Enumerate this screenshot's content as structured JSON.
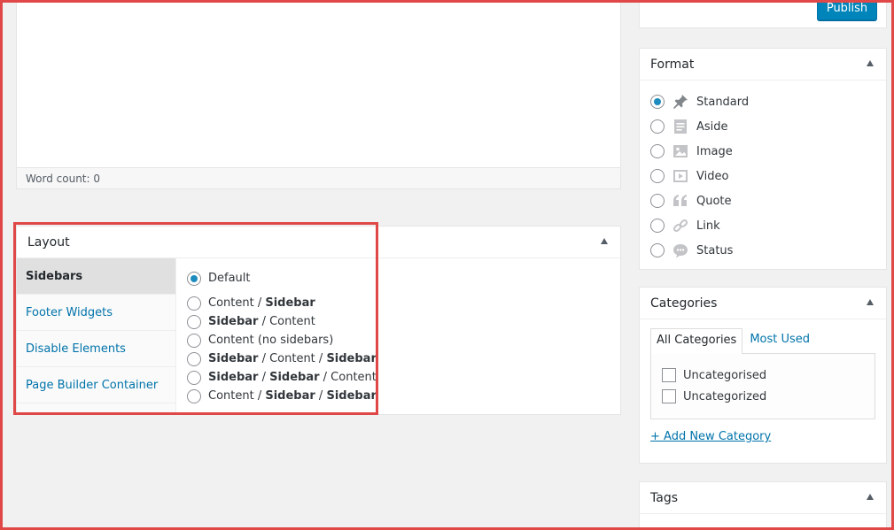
{
  "editor": {
    "word_count": "Word count: 0"
  },
  "layout": {
    "title": "Layout",
    "tabs": [
      {
        "label": "Sidebars",
        "active": true
      },
      {
        "label": "Footer Widgets",
        "active": false
      },
      {
        "label": "Disable Elements",
        "active": false
      },
      {
        "label": "Page Builder Container",
        "active": false
      }
    ],
    "default_label": "Default",
    "options": [
      {
        "parts": [
          {
            "t": "Content",
            "b": false
          },
          {
            "t": " / ",
            "b": false
          },
          {
            "t": "Sidebar",
            "b": true
          }
        ]
      },
      {
        "parts": [
          {
            "t": "Sidebar",
            "b": true
          },
          {
            "t": " / ",
            "b": false
          },
          {
            "t": "Content",
            "b": false
          }
        ]
      },
      {
        "parts": [
          {
            "t": "Content (no sidebars)",
            "b": false
          }
        ]
      },
      {
        "parts": [
          {
            "t": "Sidebar",
            "b": true
          },
          {
            "t": " / Content / ",
            "b": false
          },
          {
            "t": "Sidebar",
            "b": true
          }
        ]
      },
      {
        "parts": [
          {
            "t": "Sidebar",
            "b": true
          },
          {
            "t": " / ",
            "b": false
          },
          {
            "t": "Sidebar",
            "b": true
          },
          {
            "t": " / Content",
            "b": false
          }
        ]
      },
      {
        "parts": [
          {
            "t": "Content / ",
            "b": false
          },
          {
            "t": "Sidebar",
            "b": true
          },
          {
            "t": " / ",
            "b": false
          },
          {
            "t": "Sidebar",
            "b": true
          }
        ]
      }
    ]
  },
  "publish": {
    "button_label": "Publish"
  },
  "format": {
    "title": "Format",
    "options": [
      {
        "label": "Standard",
        "icon": "pin-icon",
        "checked": true
      },
      {
        "label": "Aside",
        "icon": "aside-icon",
        "checked": false
      },
      {
        "label": "Image",
        "icon": "image-icon",
        "checked": false
      },
      {
        "label": "Video",
        "icon": "video-icon",
        "checked": false
      },
      {
        "label": "Quote",
        "icon": "quote-icon",
        "checked": false
      },
      {
        "label": "Link",
        "icon": "link-icon",
        "checked": false
      },
      {
        "label": "Status",
        "icon": "status-icon",
        "checked": false
      }
    ]
  },
  "categories": {
    "title": "Categories",
    "tab_all": "All Categories",
    "tab_used": "Most Used",
    "items": [
      "Uncategorised",
      "Uncategorized"
    ],
    "add_new": "+ Add New Category"
  },
  "tags": {
    "title": "Tags"
  },
  "colors": {
    "accent": "#0073aa",
    "highlight": "#e04848",
    "button": "#0085ba"
  }
}
